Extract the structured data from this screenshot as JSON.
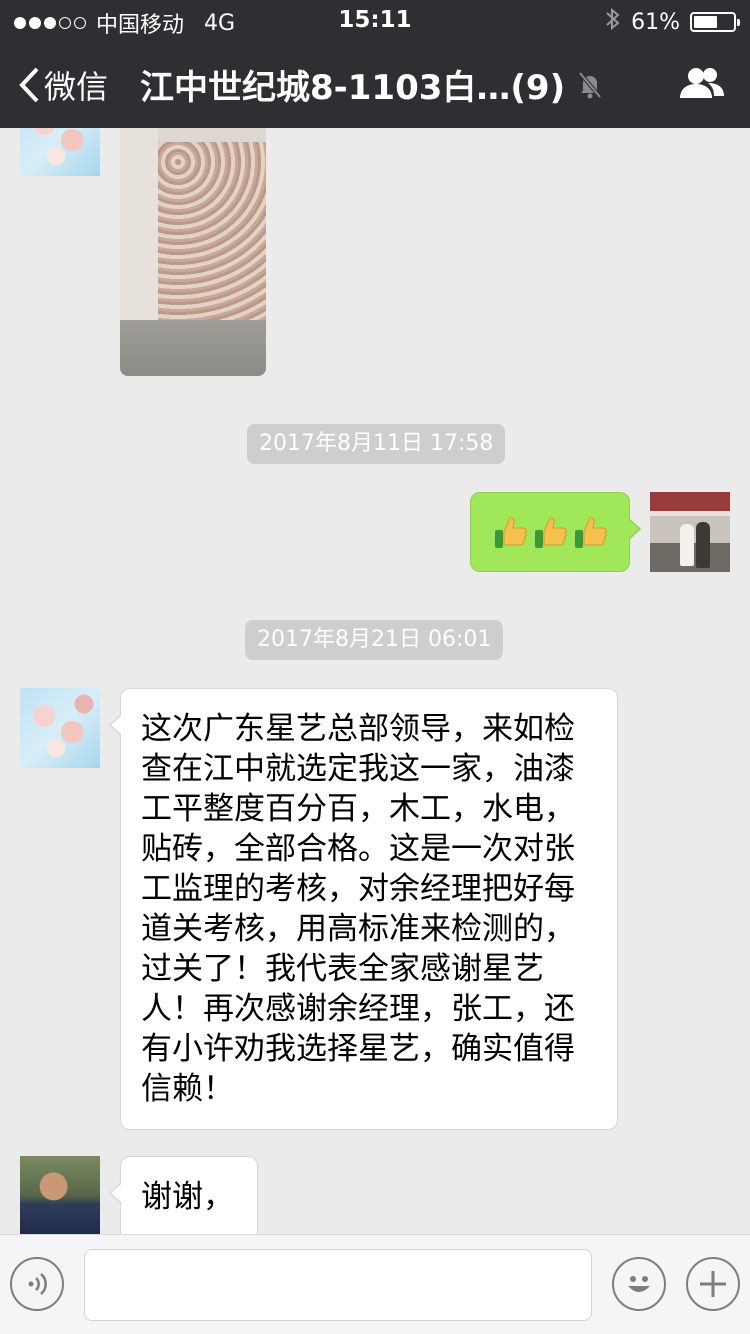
{
  "status_bar": {
    "carrier": "中国移动",
    "network": "4G",
    "time": "15:11",
    "battery_text": "61%",
    "battery_level": 0.61,
    "signal_bars_filled": 3,
    "signal_bars_total": 5
  },
  "nav": {
    "back_label": "微信",
    "title": "江中世纪城8-1103白…(9)"
  },
  "messages": {
    "timestamp_1": "2017年8月11日 17:58",
    "timestamp_2": "2017年8月21日 06:01",
    "long_text": "这次广东星艺总部领导，来如检查在江中就选定我这一家，油漆工平整度百分百，木工，水电，贴砖，全部合格。这是一次对张工监理的考核，对余经理把好每道关考核，用高标准来检测的，过关了！我代表全家感谢星艺人！再次感谢余经理，张工，还有小许劝我选择星艺，确实值得信赖！",
    "short_text": "谢谢，"
  },
  "input": {
    "value": ""
  },
  "colors": {
    "nav_bg": "#2e2f33",
    "chat_bg": "#ebebeb",
    "sent_bubble": "#a0e75a",
    "recv_bubble": "#ffffff",
    "timestamp_pill": "#cecece"
  },
  "icons": [
    "signal-dots-icon",
    "bluetooth-icon",
    "battery-icon",
    "back-chevron-icon",
    "mute-bell-icon",
    "group-members-icon",
    "thumbs-up-icon",
    "voice-icon",
    "emoji-icon",
    "plus-icon"
  ]
}
